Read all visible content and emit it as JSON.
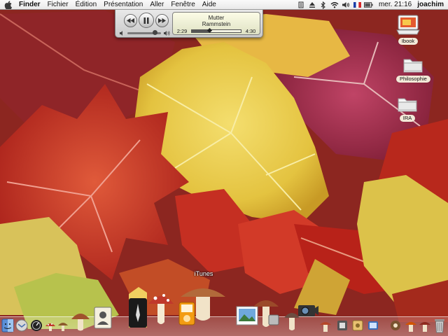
{
  "menubar": {
    "app_name": "Finder",
    "menus": [
      "Fichier",
      "Édition",
      "Présentation",
      "Aller",
      "Fenêtre",
      "Aide"
    ],
    "clock": "mer. 21:16",
    "user": "joachim",
    "status_icons": [
      "script-icon",
      "eject-icon",
      "bluetooth-icon",
      "wifi-icon",
      "volume-icon",
      "flag-icon",
      "battery-icon"
    ]
  },
  "mini_player": {
    "title": "Mutter",
    "artist": "Rammstein",
    "elapsed": "2:29",
    "remaining": "4:30",
    "progress": 0.36,
    "volume": 0.82
  },
  "desktop": {
    "icons": [
      {
        "label": "Ibook",
        "icon": "hard-drive-icon"
      },
      {
        "label": "Philosophie",
        "icon": "folder-icon"
      },
      {
        "label": "IRA",
        "icon": "folder-icon"
      }
    ]
  },
  "dock": {
    "tooltip": "iTunes",
    "items": [
      "finder-icon",
      "mail-icon",
      "dashboard-icon",
      "mushroom-icon",
      "mushroom-icon",
      "mushroom-icon",
      "address-book-icon",
      "itunes-icon",
      "mushroom-icon",
      "ipod-icon",
      "preview-icon",
      "mushroom-icon",
      "camera-icon",
      "mushroom-icon",
      "mushroom-icon",
      "mushroom-icon",
      "mushroom-icon",
      "trash-icon"
    ]
  }
}
